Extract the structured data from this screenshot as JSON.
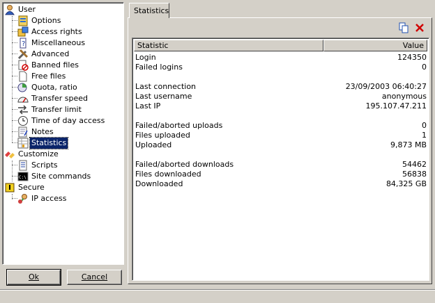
{
  "tree": {
    "user": {
      "label": "User",
      "items": [
        {
          "label": "Options",
          "icon": "options-icon"
        },
        {
          "label": "Access rights",
          "icon": "access-rights-icon"
        },
        {
          "label": "Miscellaneous",
          "icon": "miscellaneous-icon"
        },
        {
          "label": "Advanced",
          "icon": "advanced-icon"
        },
        {
          "label": "Banned files",
          "icon": "banned-files-icon"
        },
        {
          "label": "Free files",
          "icon": "free-files-icon"
        },
        {
          "label": "Quota, ratio",
          "icon": "quota-icon"
        },
        {
          "label": "Transfer speed",
          "icon": "speedometer-icon"
        },
        {
          "label": "Transfer limit",
          "icon": "transfer-limit-icon"
        },
        {
          "label": "Time of day access",
          "icon": "clock-icon"
        },
        {
          "label": "Notes",
          "icon": "notes-icon"
        },
        {
          "label": "Statistics",
          "icon": "statistics-icon",
          "selected": true
        }
      ]
    },
    "customize": {
      "label": "Customize",
      "items": [
        {
          "label": "Scripts",
          "icon": "scripts-icon"
        },
        {
          "label": "Site commands",
          "icon": "command-prompt-icon"
        }
      ]
    },
    "secure": {
      "label": "Secure",
      "items": [
        {
          "label": "IP access",
          "icon": "ip-access-icon"
        }
      ]
    }
  },
  "buttons": {
    "ok": "Ok",
    "cancel": "Cancel"
  },
  "tab": {
    "label": "Statistics"
  },
  "list": {
    "col_statistic": "Statistic",
    "col_value": "Value",
    "rows": [
      {
        "k": "Login",
        "v": "124350"
      },
      {
        "k": "Failed logins",
        "v": "0"
      },
      {
        "k": "Last connection",
        "v": "23/09/2003 06:40:27"
      },
      {
        "k": "Last username",
        "v": "anonymous"
      },
      {
        "k": "Last IP",
        "v": "195.107.47.211"
      },
      {
        "k": "Failed/aborted uploads",
        "v": "0"
      },
      {
        "k": "Files uploaded",
        "v": "1"
      },
      {
        "k": "Uploaded",
        "v": "9,873 MB"
      },
      {
        "k": "Failed/aborted downloads",
        "v": "54462"
      },
      {
        "k": "Files downloaded",
        "v": "56838"
      },
      {
        "k": "Downloaded",
        "v": "84,325 GB"
      }
    ]
  },
  "colors": {
    "selection": "#0a246a",
    "face": "#d4d0c8",
    "delete": "#d00000"
  }
}
